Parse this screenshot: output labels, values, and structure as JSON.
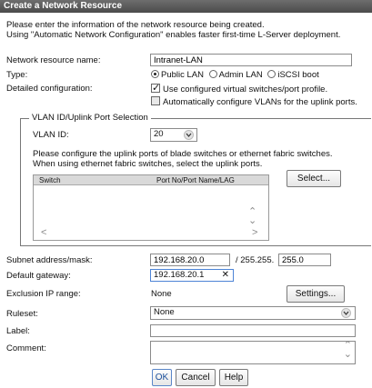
{
  "window": {
    "title": "Create a Network Resource",
    "ghost_title": "Network Resource"
  },
  "description": [
    "Please enter the information of the network resource being created.",
    "Using \"Automatic Network Configuration\" enables faster first-time L-Server deployment."
  ],
  "form": {
    "name_label": "Network resource name:",
    "name_value": "Intranet-LAN",
    "type_label": "Type:",
    "type_options": [
      "Public LAN",
      "Admin LAN",
      "iSCSI boot"
    ],
    "type_selected": "Public LAN",
    "detailed_label": "Detailed configuration:",
    "check_virtual": "Use configured virtual switches/port profile.",
    "check_virtual_checked": true,
    "check_vlan": "Automatically configure VLANs for the uplink ports.",
    "check_vlan_checked": false
  },
  "vlan_group": {
    "legend": "VLAN ID/Uplink Port Selection",
    "vlan_label": "VLAN ID:",
    "vlan_value": "20",
    "instructions": [
      "Please configure the uplink ports of blade switches or ethernet fabric switches.",
      "When using ethernet fabric switches, select the uplink ports."
    ],
    "columns": [
      "Switch",
      "Port No/Port Name/LAG"
    ],
    "select_button": "Select..."
  },
  "network": {
    "subnet_label": "Subnet address/mask:",
    "subnet_value": "192.168.20.0",
    "mask_prefix": "/ 255.255.",
    "mask_value": "255.0",
    "gateway_label": "Default gateway:",
    "gateway_value": "192.168.20.1",
    "exclusion_label": "Exclusion IP range:",
    "exclusion_value": "None",
    "settings_button": "Settings...",
    "ruleset_label": "Ruleset:",
    "ruleset_value": "None",
    "label_label": "Label:",
    "label_value": "",
    "comment_label": "Comment:",
    "comment_value": ""
  },
  "footer": {
    "ok": "OK",
    "cancel": "Cancel",
    "help": "Help"
  },
  "icons": {
    "clear": "close-icon",
    "dropdown": "chevron-down-icon"
  }
}
